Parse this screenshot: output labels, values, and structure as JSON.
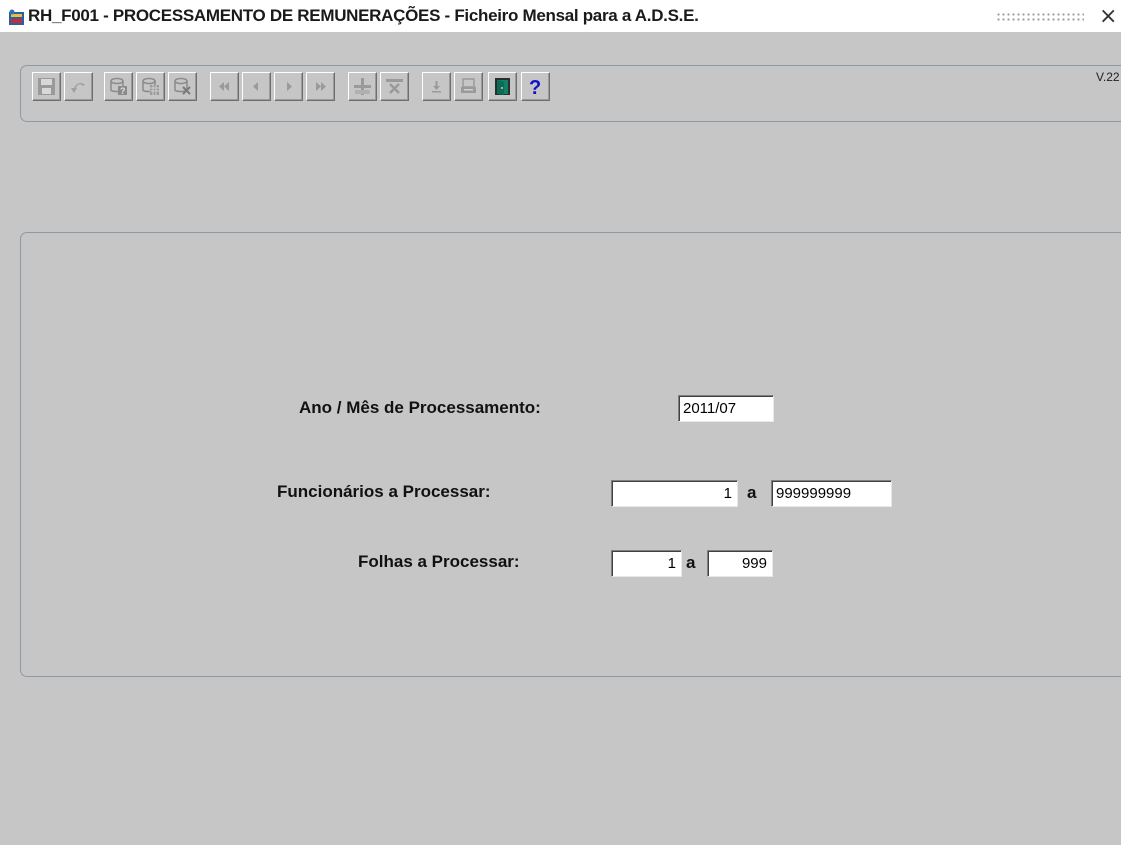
{
  "window": {
    "title": "RH_F001 - PROCESSAMENTO DE REMUNERAÇÕES - Ficheiro Mensal para a A.D.S.E.",
    "close_glyph": "×",
    "icon": "app-form-icon"
  },
  "toolbar": {
    "version": "V.22",
    "buttons": [
      {
        "name": "save-icon",
        "enabled": false
      },
      {
        "name": "undo-icon",
        "enabled": false
      },
      {
        "name": "query-icon",
        "enabled": false
      },
      {
        "name": "execute-query-icon",
        "enabled": false
      },
      {
        "name": "cancel-query-icon",
        "enabled": false
      },
      {
        "name": "first-record-icon",
        "enabled": false
      },
      {
        "name": "previous-record-icon",
        "enabled": false
      },
      {
        "name": "next-record-icon",
        "enabled": false
      },
      {
        "name": "last-record-icon",
        "enabled": false
      },
      {
        "name": "insert-record-icon",
        "enabled": false
      },
      {
        "name": "delete-record-icon",
        "enabled": false
      },
      {
        "name": "download-icon",
        "enabled": false
      },
      {
        "name": "print-icon",
        "enabled": false
      },
      {
        "name": "exit-door-icon",
        "enabled": true
      },
      {
        "name": "help-icon",
        "enabled": true
      }
    ],
    "colors": {
      "disabled": "#9a9a9a",
      "help": "#1010c8",
      "exit": "#10806a"
    }
  },
  "form": {
    "ano_mes": {
      "label": "Ano / Mês de Processamento:",
      "value": "2011/07"
    },
    "funcionarios": {
      "label": "Funcionários a Processar:",
      "from": "1",
      "separator": "a",
      "to": "999999999"
    },
    "folhas": {
      "label": "Folhas a Processar:",
      "from": "1",
      "separator": "a",
      "to": "999"
    }
  }
}
